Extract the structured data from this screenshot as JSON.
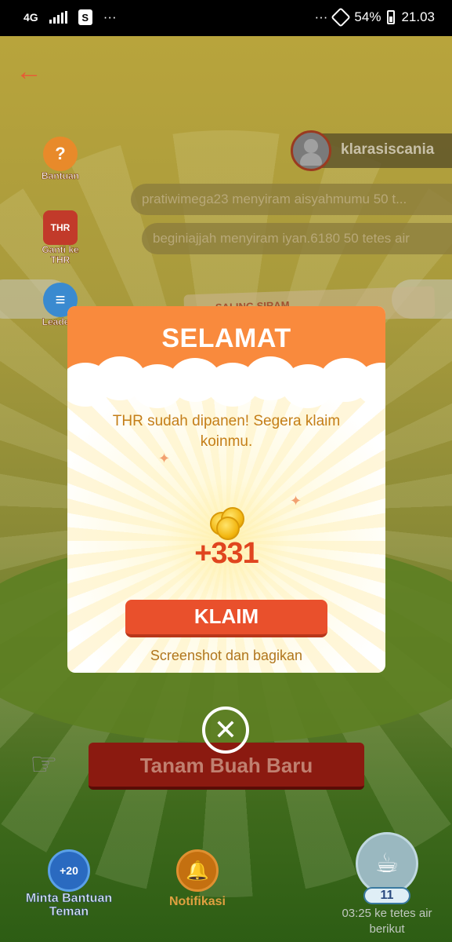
{
  "status_bar": {
    "network": "4G",
    "app_icon": "S",
    "more_left": "···",
    "more_right": "···",
    "battery": "54%",
    "time": "21.03"
  },
  "scene": {
    "side_menu": [
      {
        "label": "Bantuan",
        "icon": "question-icon",
        "symbol": "?"
      },
      {
        "label": "Ganti ke THR",
        "icon": "thr-icon",
        "symbol": "THR"
      },
      {
        "label": "Leaderb",
        "icon": "leaderboard-icon",
        "symbol": "≡"
      }
    ],
    "username": "klarasiscania",
    "feed": [
      "pratiwimega23 menyiram aisyahmumu 50 t...",
      "beginiajjah menyiram iyan.6180 50 tetes air"
    ],
    "banner_text": "SALING SIRAM",
    "plant_button": "Tanam Buah Baru",
    "bottom": {
      "ask_help_badge": "+20",
      "ask_help_label": "Minta Bantuan Teman",
      "notification_label": "Notifikasi",
      "water_count": "11",
      "water_timer": "03:25 ke tetes air berikut"
    }
  },
  "modal": {
    "title": "SELAMAT",
    "message": "THR sudah dipanen! Segera klaim koinmu.",
    "reward": "+331",
    "claim_button": "KLAIM",
    "share_link": "Screenshot dan bagikan"
  },
  "colors": {
    "modal_header": "#f98a3d",
    "claim_button": "#e9502c",
    "reward_text": "#e0451f",
    "message_text": "#c47e18"
  }
}
